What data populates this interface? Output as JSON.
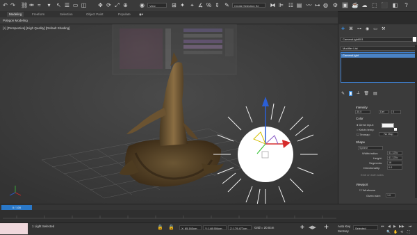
{
  "toolbar": {
    "view_dropdown": "View",
    "selection_set": "Create Selection Se"
  },
  "ribbon": {
    "tabs": [
      "Modeling",
      "Freeform",
      "Selection",
      "Object Paint",
      "Populate"
    ],
    "active_tab": "Modeling",
    "polygon_modeling": "Polygon Modeling"
  },
  "viewport": {
    "label": "[+] [Perspective] [High Quality] [Default Shading]"
  },
  "panel": {
    "object_name": "CameraLight001",
    "modifier_list": "Modifier List",
    "stack_item": "CameraLight",
    "intensity": {
      "title": "Intensity",
      "value": "30.0",
      "unit": "Def",
      "mult": "0"
    },
    "color": {
      "title": "Color",
      "options": [
        "Direct input:",
        "Kelvin temp:",
        "Texmap:"
      ],
      "texmap_value": "No Map"
    },
    "shape": {
      "title": "Shape",
      "type": "Sphere",
      "params": [
        {
          "label": "Width/radius:",
          "value": "41.125c"
        },
        {
          "label": "Height:",
          "value": "41.125c"
        },
        {
          "label": "Segments:",
          "value": "16"
        },
        {
          "label": "Directionality:",
          "value": "0.0"
        }
      ],
      "note": "Emit on both sides"
    },
    "viewport": {
      "title": "Viewport",
      "wireframe": "Wireframe",
      "gizmo_label": "Gizmo size:",
      "gizmo_value": "1.0"
    }
  },
  "timeline": {
    "frame": "0 / 100"
  },
  "status": {
    "message": "1 Light Selected",
    "x": "X: 65.163cm",
    "y": "Y: 148.904cm",
    "z": "Z: 179.477cm",
    "grid": "Grid = 20.0cm",
    "auto_key": "Auto Key",
    "selected": "Selected",
    "set_key": "Set Key"
  },
  "colors": {
    "accent": "#2b6fb5",
    "selection": "#4a82c4",
    "light": "#ffffff"
  }
}
